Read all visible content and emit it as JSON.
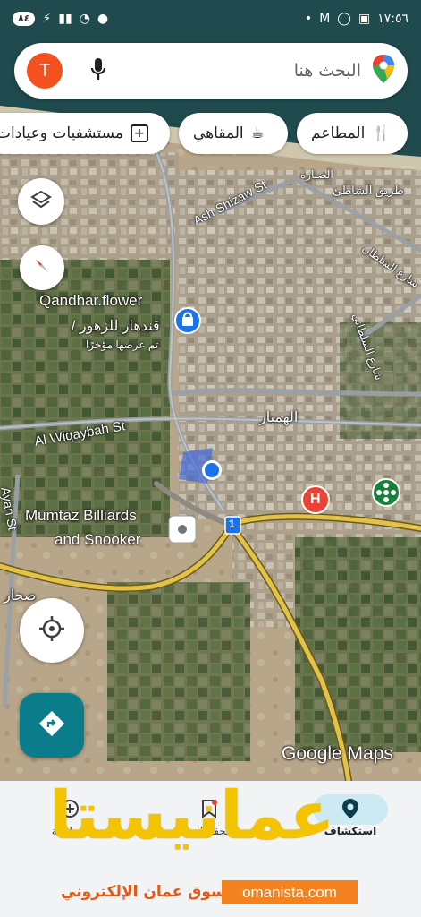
{
  "status_bar": {
    "time": "١٧:٥٦",
    "battery": "٨٤",
    "right_icons": [
      "location-icon",
      "wifi-icon",
      "signal-icon",
      "charging-icon"
    ],
    "left_icons": [
      "dot-icon",
      "gmail-icon",
      "whatsapp-icon",
      "screenshot-icon"
    ]
  },
  "search": {
    "placeholder": "البحث هنا",
    "avatar_letter": "T"
  },
  "chips": [
    {
      "label": "المطاعم",
      "icon": "fork-knife-icon"
    },
    {
      "label": "المقاهي",
      "icon": "coffee-icon"
    },
    {
      "label": "مستشفيات وعيادات",
      "icon": "hospital-icon"
    }
  ],
  "map": {
    "labels": {
      "street_ash_shizaw": "Ash Shizaw St",
      "street_shati": "طريق الشاطئ",
      "place_dbara": "الضبارة",
      "street_sultani": "شارع السلطاني",
      "street_sultan_qaboos": "شارع السلطان",
      "qandhar_en": "Qandhar.flower",
      "qandhar_ar": "/ قندهار للزهور",
      "qandhar_note": "تم عرضها مؤخرًا",
      "al_wiqaybah": "Al Wiqaybah St",
      "al_hambar": "الهمبار",
      "billiards_line1": "Mumtaz Billiards",
      "billiards_line2": "and Snooker",
      "route_number": "1",
      "left_edge_street": "Ayan St",
      "left_edge_place": "صحار",
      "hospital_letter": "H",
      "attribution": "Google Maps"
    }
  },
  "bottom_nav": {
    "tabs": [
      {
        "label": "استكشاف",
        "icon": "explore-icon",
        "active": true
      },
      {
        "label": "محفوظات",
        "icon": "saved-icon",
        "active": false
      },
      {
        "label": "مساهمة",
        "icon": "contribute-icon",
        "active": false
      }
    ]
  },
  "watermark": {
    "brand": "عمانيستا",
    "subtitle": "سوق عمان الإلكتروني",
    "url": "omanista.com"
  },
  "colors": {
    "accent": "#0b7c8a",
    "avatar": "#f4511e",
    "road_yellow": "#e2c24a",
    "location_blue": "#1a73e8",
    "watermark_yellow": "#f5c400",
    "watermark_orange": "#f4821e"
  }
}
